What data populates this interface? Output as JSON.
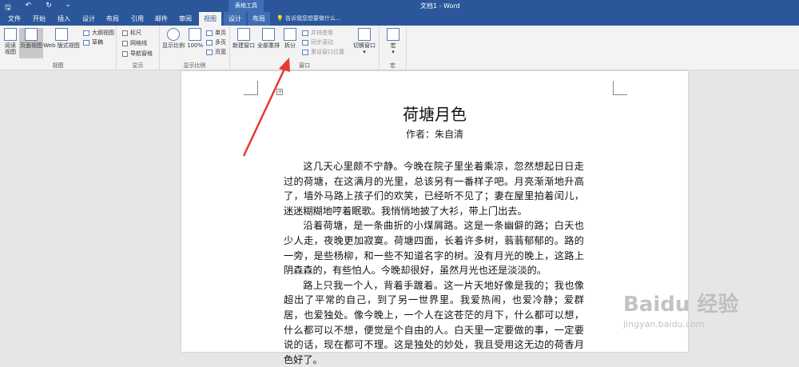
{
  "titlebar": {
    "contextual_title": "表格工具",
    "document_title": "文档1 - Word",
    "qat": [
      "🖫",
      "↶",
      "↻",
      "₌"
    ]
  },
  "tabs": [
    "文件",
    "开始",
    "插入",
    "设计",
    "布局",
    "引用",
    "邮件",
    "审阅",
    "视图",
    "设计",
    "布局"
  ],
  "active_tab_index": 8,
  "tell_me": "告诉我您想要做什么...",
  "ribbon": {
    "views": {
      "label": "视图",
      "read_mode": "阅读\n视图",
      "print_layout": "页面视图",
      "web_layout": "Web 版式视图",
      "outline": "大纲视图",
      "draft": "草稿"
    },
    "show": {
      "label": "显示",
      "ruler": "标尺",
      "gridlines": "网格线",
      "nav_pane": "导航窗格"
    },
    "zoom": {
      "label": "显示比例",
      "zoom": "显示比例",
      "hundred": "100%",
      "one_page": "单页",
      "multi_page": "多页",
      "page_width": "页宽"
    },
    "window": {
      "label": "窗口",
      "new_window": "新建窗口",
      "arrange_all": "全部重排",
      "split": "拆分",
      "side_by_side": "并排查看",
      "sync_scroll": "同步滚动",
      "reset_pos": "重设窗口位置",
      "switch_windows": "切换窗口"
    },
    "macros": {
      "label": "宏",
      "macros": "宏"
    }
  },
  "document": {
    "title": "荷塘月色",
    "author": "作者：朱自清",
    "paragraphs": [
      "这几天心里颇不宁静。今晚在院子里坐着乘凉，忽然想起日日走过的荷塘，在这满月的光里，总该另有一番样子吧。月亮渐渐地升高了，墙外马路上孩子们的欢笑，已经听不见了；妻在屋里拍着闰儿，迷迷糊糊地哼着眠歌。我悄悄地披了大衫，带上门出去。",
      "沿着荷塘，是一条曲折的小煤屑路。这是一条幽僻的路；白天也少人走，夜晚更加寂寞。荷塘四面，长着许多树，蓊蓊郁郁的。路的一旁，是些杨柳，和一些不知道名字的树。没有月光的晚上，这路上阴森森的，有些怕人。今晚却很好，虽然月光也还是淡淡的。",
      "路上只我一个人，背着手踱着。这一片天地好像是我的；我也像超出了平常的自己，到了另一世界里。我爱热闹，也爱冷静；爱群居，也爱独处。像今晚上，一个人在这苍茫的月下，什么都可以想，什么都可以不想，便觉是个自由的人。白天里一定要做的事，一定要说的话，现在都可不理。这是独处的妙处，我且受用这无边的荷香月色好了。"
    ]
  },
  "watermark": {
    "brand": "Baidu 经验",
    "url": "jingyan.baidu.com"
  }
}
